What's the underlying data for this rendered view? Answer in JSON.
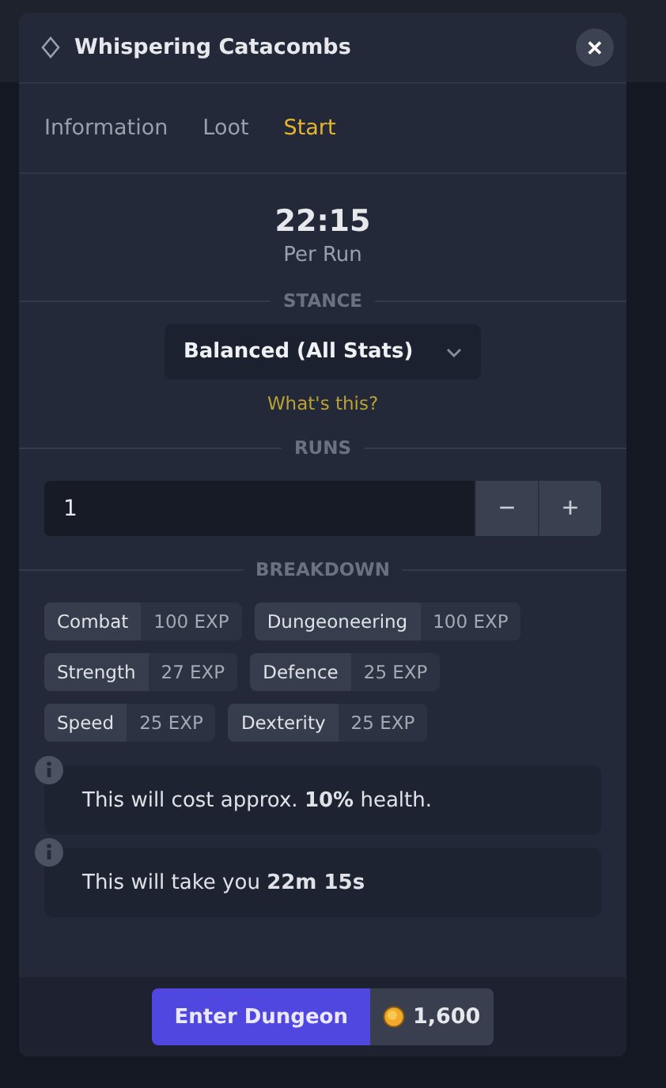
{
  "window": {
    "title": "Whispering Catacombs",
    "close": "✕"
  },
  "tabs": [
    {
      "label": "Information",
      "selected": false
    },
    {
      "label": "Loot",
      "selected": false
    },
    {
      "label": "Start",
      "selected": true
    }
  ],
  "duration": {
    "time": "22:15",
    "caption": "Per Run"
  },
  "stance": {
    "heading": "STANCE",
    "value": "Balanced (All Stats)",
    "help_link": "What's this?"
  },
  "runs": {
    "heading": "RUNS",
    "value": "1",
    "decrement": "−",
    "increment": "+"
  },
  "breakdown": {
    "heading": "BREAKDOWN",
    "rows": [
      [
        {
          "skill": "Combat",
          "exp": "100 EXP"
        },
        {
          "skill": "Dungeoneering",
          "exp": "100 EXP"
        }
      ],
      [
        {
          "skill": "Strength",
          "exp": "27 EXP"
        },
        {
          "skill": "Defence",
          "exp": "25 EXP"
        }
      ],
      [
        {
          "skill": "Speed",
          "exp": "25 EXP"
        },
        {
          "skill": "Dexterity",
          "exp": "25 EXP"
        }
      ]
    ]
  },
  "notes": [
    "This will cost approx. **10%** health.",
    "This will take you **22m 15s**"
  ],
  "footer": {
    "button": "Enter Dungeon",
    "cost": "1,600"
  }
}
